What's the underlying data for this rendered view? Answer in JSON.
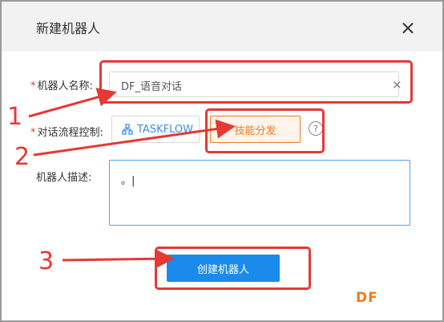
{
  "dialog": {
    "title": "新建机器人",
    "close_icon": "close-icon"
  },
  "form": {
    "name": {
      "required": "*",
      "label": "机器人名称:",
      "value": "DF_语音对话",
      "clear_icon": "clear-icon"
    },
    "flow_control": {
      "required": "*",
      "label": "对话流程控制:",
      "options": [
        {
          "label": "TASKFLOW",
          "icon": "taskflow-icon",
          "selected": false
        },
        {
          "label": "技能分发",
          "selected": true
        }
      ],
      "help_icon": "?"
    },
    "description": {
      "label": "机器人描述:",
      "value": "。|"
    },
    "create_button": "创建机器人"
  },
  "annotations": {
    "steps": [
      "1",
      "2",
      "3"
    ],
    "color": "#e53935"
  },
  "watermark": "DF",
  "colors": {
    "primary": "#1a8bea",
    "accent": "#f07b1a",
    "required": "#e0463b"
  }
}
